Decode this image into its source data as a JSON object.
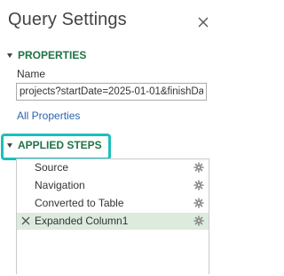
{
  "pane": {
    "title": "Query Settings"
  },
  "properties": {
    "header": "PROPERTIES",
    "name_label": "Name",
    "name_value": "projects?startDate=2025-01-01&finishDate",
    "all_properties_link": "All Properties"
  },
  "applied_steps": {
    "header": "APPLIED STEPS",
    "steps": [
      {
        "label": "Source",
        "selected": false
      },
      {
        "label": "Navigation",
        "selected": false
      },
      {
        "label": "Converted to Table",
        "selected": false
      },
      {
        "label": "Expanded Column1",
        "selected": true
      }
    ]
  },
  "colors": {
    "section_header": "#217346",
    "link": "#2a64b0",
    "selected_row": "#dcebde",
    "highlight": "#1dbfbb"
  },
  "icons": {
    "close": "close-icon",
    "step_settings": "gear-icon",
    "delete_step": "delete-step-icon",
    "collapse": "collapse-triangle-icon"
  }
}
